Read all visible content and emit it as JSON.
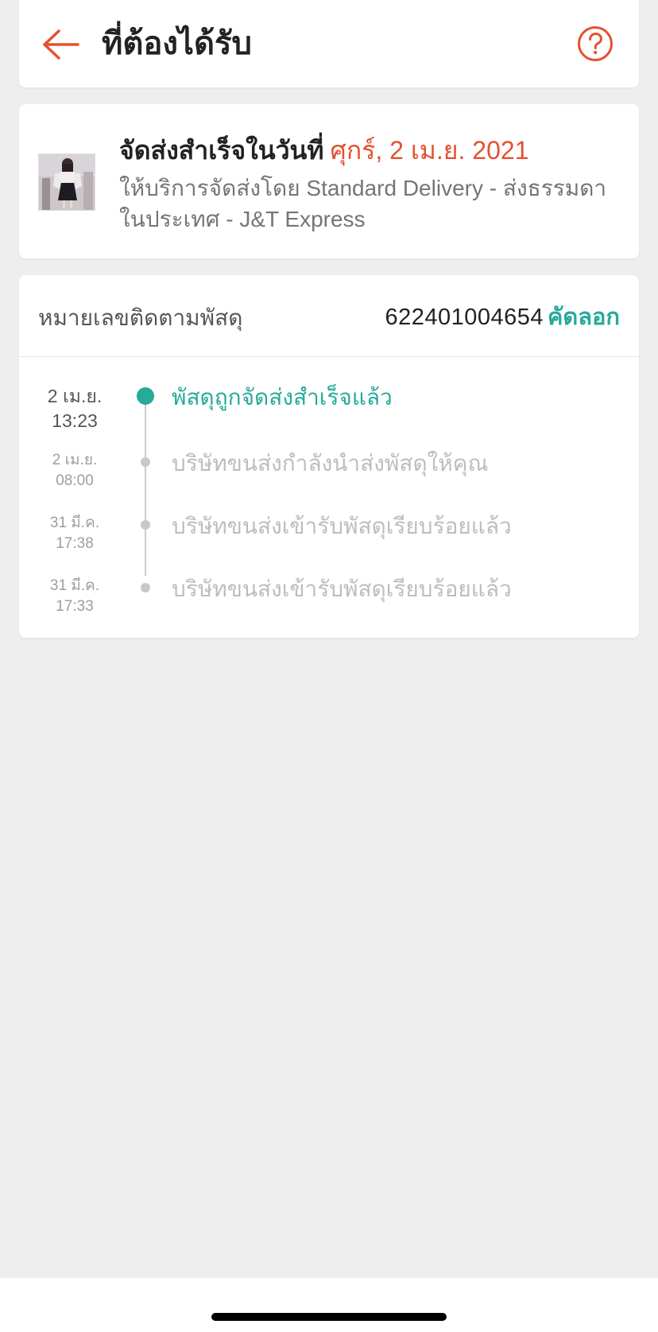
{
  "header": {
    "title": "ที่ต้องได้รับ",
    "back_icon": "arrow-left-icon",
    "help_icon": "question-circle-icon"
  },
  "delivery": {
    "label": "จัดส่งสำเร็จในวันที่",
    "date": "ศุกร์, 2 เม.ย. 2021",
    "service": "ให้บริการจัดส่งโดย Standard Delivery - ส่งธรรมดาในประเทศ - J&T Express"
  },
  "tracking": {
    "label": "หมายเลขติดตามพัสดุ",
    "number": "622401004654",
    "copy_label": "คัดลอก"
  },
  "events": [
    {
      "date": "2 เม.ย.",
      "time": "13:23",
      "desc": "พัสดุถูกจัดส่งสำเร็จแล้ว"
    },
    {
      "date": "2 เม.ย.",
      "time": "08:00",
      "desc": "บริษัทขนส่งกำลังนำส่งพัสดุให้คุณ"
    },
    {
      "date": "31 มี.ค.",
      "time": "17:38",
      "desc": "บริษัทขนส่งเข้ารับพัสดุเรียบร้อยแล้ว"
    },
    {
      "date": "31 มี.ค.",
      "time": "17:33",
      "desc": "บริษัทขนส่งเข้ารับพัสดุเรียบร้อยแล้ว"
    }
  ],
  "colors": {
    "accent": "#e4512f",
    "success": "#26aa99",
    "background": "#eeeeee"
  }
}
